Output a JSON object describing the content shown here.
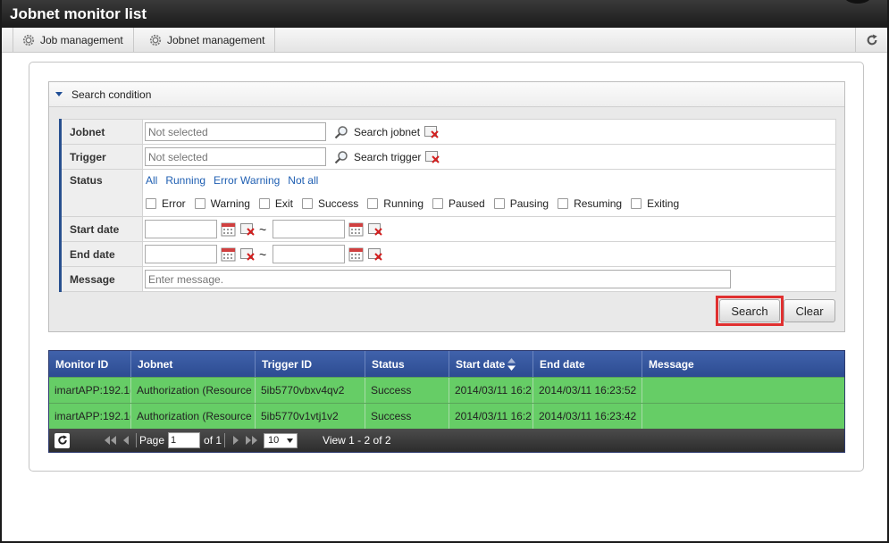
{
  "window": {
    "title": "Jobnet monitor list"
  },
  "toolbar": {
    "job_management": "Job management",
    "jobnet_management": "Jobnet management"
  },
  "search_panel": {
    "header": "Search condition",
    "jobnet": {
      "label": "Jobnet",
      "placeholder": "Not selected",
      "search_link": "Search jobnet"
    },
    "trigger": {
      "label": "Trigger",
      "placeholder": "Not selected",
      "search_link": "Search trigger"
    },
    "status": {
      "label": "Status",
      "links": [
        "All",
        "Running",
        "Error Warning",
        "Not all"
      ],
      "checks": [
        "Error",
        "Warning",
        "Exit",
        "Success",
        "Running",
        "Paused",
        "Pausing",
        "Resuming",
        "Exiting"
      ]
    },
    "start_date": {
      "label": "Start date",
      "tilde": "~"
    },
    "end_date": {
      "label": "End date",
      "tilde": "~"
    },
    "message": {
      "label": "Message",
      "placeholder": "Enter message."
    },
    "search_button": "Search",
    "clear_button": "Clear"
  },
  "grid": {
    "columns": [
      "Monitor ID",
      "Jobnet",
      "Trigger ID",
      "Status",
      "Start date",
      "End date",
      "Message"
    ],
    "rows": [
      {
        "monitor_id": "imartAPP:192.1(",
        "jobnet": "Authorization (Resource",
        "trigger_id": "5ib5770vbxv4qv2",
        "status": "Success",
        "start_date": "2014/03/11 16:2",
        "end_date": "2014/03/11 16:23:52",
        "message": ""
      },
      {
        "monitor_id": "imartAPP:192.1(",
        "jobnet": "Authorization (Resource",
        "trigger_id": "5ib5770v1vtj1v2",
        "status": "Success",
        "start_date": "2014/03/11 16:2",
        "end_date": "2014/03/11 16:23:42",
        "message": ""
      }
    ],
    "pager": {
      "page_label": "Page",
      "page_value": "1",
      "of_label": "of 1",
      "page_size": "10",
      "view_text": "View 1 - 2 of 2"
    }
  },
  "colors": {
    "header_blue": "#2d4c92",
    "row_success": "#66cd66",
    "highlight_red": "#e03030"
  }
}
